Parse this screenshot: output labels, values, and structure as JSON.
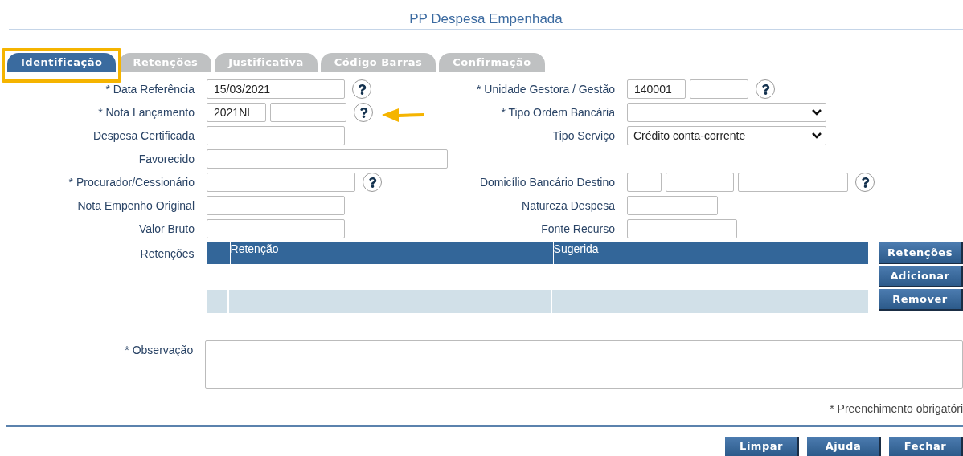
{
  "title": "PP Despesa Empenhada",
  "tabs": [
    {
      "label": "Identificação",
      "selected": true
    },
    {
      "label": "Retenções",
      "selected": false
    },
    {
      "label": "Justificativa",
      "selected": false
    },
    {
      "label": "Código Barras",
      "selected": false
    },
    {
      "label": "Confirmação",
      "selected": false
    }
  ],
  "rows": [
    {
      "left": {
        "label": "* Data Referência",
        "inputs": [
          {
            "kind": "text",
            "value": "15/03/2021"
          }
        ],
        "help": true
      },
      "right": {
        "label": "* Unidade Gestora / Gestão",
        "inputs": [
          {
            "kind": "text",
            "value": "140001"
          },
          {
            "kind": "text"
          }
        ],
        "help": true
      }
    },
    {
      "left": {
        "label": "* Nota Lançamento",
        "inputs": [
          {
            "kind": "text",
            "value": "2021NL"
          },
          {
            "kind": "text"
          }
        ],
        "help": true
      },
      "right": {
        "label": "* Tipo Ordem Bancária",
        "inputs": [
          {
            "kind": "select"
          }
        ],
        "help": false
      }
    },
    {
      "left": {
        "label": "Despesa Certificada",
        "inputs": [
          {
            "kind": "text"
          }
        ],
        "help": false
      },
      "right": {
        "label": "Tipo Serviço",
        "inputs": [
          {
            "kind": "select",
            "value": "Crédito conta-corrente"
          }
        ],
        "help": false
      }
    },
    {
      "left": {
        "label": "Favorecido",
        "inputs": [
          {
            "kind": "text"
          }
        ],
        "help": false
      }
    },
    {
      "left": {
        "label": "* Procurador/Cessionário",
        "inputs": [
          {
            "kind": "text"
          }
        ],
        "help": true
      },
      "right": {
        "label": "Domicílio Bancário Destino",
        "inputs": [
          {
            "kind": "text"
          },
          {
            "kind": "text"
          },
          {
            "kind": "text"
          }
        ],
        "help": true
      }
    },
    {
      "left": {
        "label": "Nota Empenho Original",
        "inputs": [
          {
            "kind": "text"
          }
        ],
        "help": false
      },
      "right": {
        "label": "Natureza Despesa",
        "inputs": [
          {
            "kind": "text"
          }
        ],
        "help": false
      }
    },
    {
      "left": {
        "label": "Valor Bruto",
        "inputs": [
          {
            "kind": "text"
          }
        ],
        "help": false
      },
      "right": {
        "label": "Fonte Recurso",
        "inputs": [
          {
            "kind": "text"
          }
        ],
        "help": false
      }
    }
  ],
  "retencoes": {
    "label": "Retenções",
    "columns": [
      "Retenção",
      "Sugerida"
    ],
    "buttons": [
      "Retenções",
      "Adicionar",
      "Remover"
    ]
  },
  "observacao": {
    "label": "* Observação"
  },
  "note": "* Preenchimento obrigatóri",
  "footer_buttons": [
    "Limpar",
    "Ajuda",
    "Fechar"
  ]
}
